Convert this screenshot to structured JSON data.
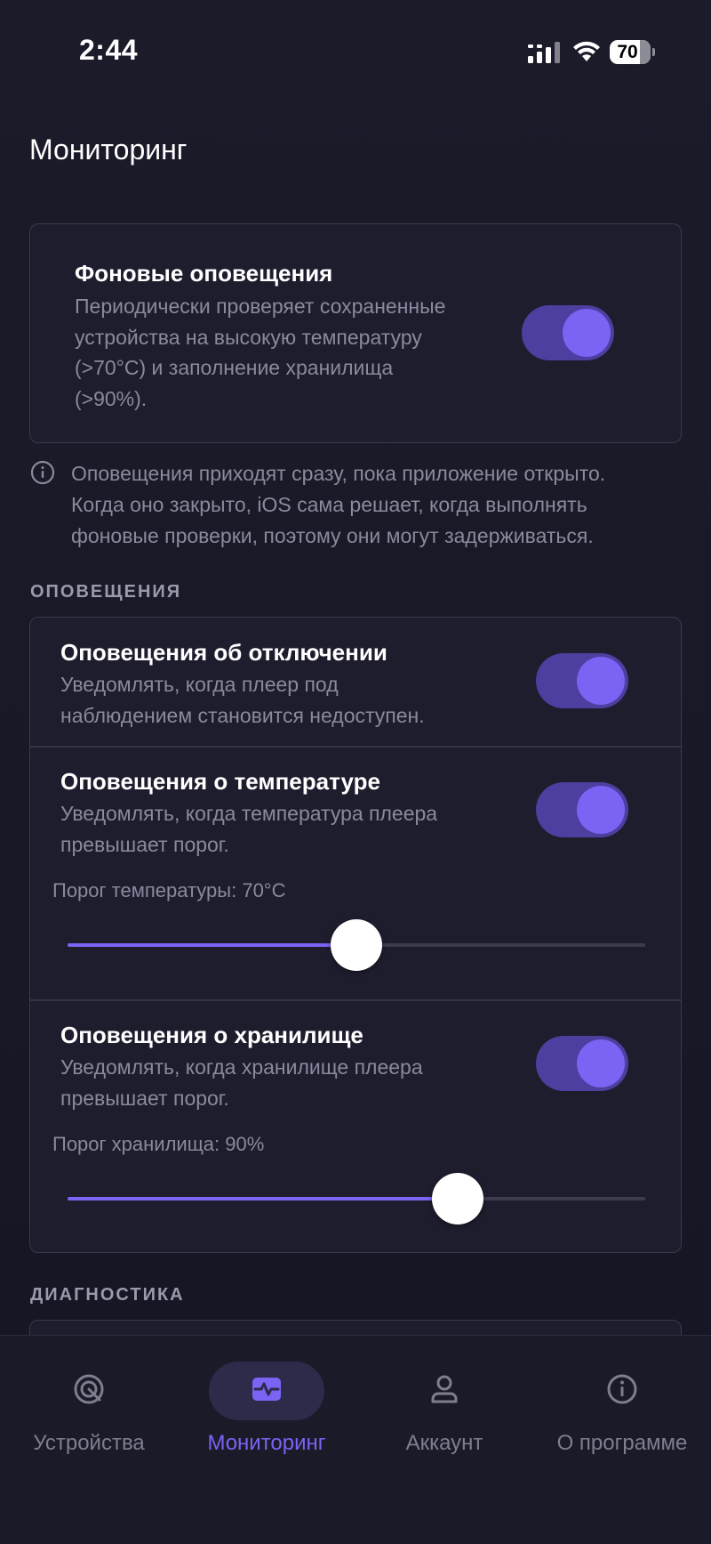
{
  "status_bar": {
    "time": "2:44",
    "battery": "70"
  },
  "page": {
    "title": "Мониторинг"
  },
  "background_alerts": {
    "title": "Фоновые оповещения",
    "description_lines": [
      "Периодически проверяет сохраненные",
      "устройства на высокую температуру",
      "(>70°C) и заполнение хранилища",
      "(>90%)."
    ],
    "enabled": true
  },
  "info_note": {
    "lines": [
      "Оповещения приходят сразу, пока приложение открыто.",
      "Когда оно закрыто, iOS сама решает, когда выполнять",
      "фоновые проверки, поэтому они могут задерживаться."
    ]
  },
  "alerts_section": {
    "header": "ОПОВЕЩЕНИЯ",
    "offline": {
      "title": "Оповещения об отключении",
      "description_lines": [
        "Уведомлять, когда плеер под",
        "наблюдением становится недоступен."
      ],
      "enabled": true
    },
    "temperature": {
      "title": "Оповещения о температуре",
      "description_lines": [
        "Уведомлять, когда температура плеера",
        "превышает порог."
      ],
      "enabled": true,
      "threshold_label": "Порог температуры: 70°C",
      "slider_fraction": 0.5
    },
    "storage": {
      "title": "Оповещения о хранилище",
      "description_lines": [
        "Уведомлять, когда хранилище плеера",
        "превышает порог."
      ],
      "enabled": true,
      "threshold_label": "Порог хранилища: 90%",
      "slider_fraction": 0.675
    }
  },
  "diagnostics_section": {
    "header": "ДИАГНОСТИКА"
  },
  "tabbar": {
    "tabs": [
      {
        "label": "Устройства",
        "icon": "target-icon",
        "active": false
      },
      {
        "label": "Мониторинг",
        "icon": "pulse-monitor-icon",
        "active": true
      },
      {
        "label": "Аккаунт",
        "icon": "person-icon",
        "active": false
      },
      {
        "label": "О программе",
        "icon": "info-circle-icon",
        "active": false
      }
    ]
  },
  "colors": {
    "accent": "#7b63f3",
    "toggle_track": "#4d3f9f",
    "background": "#1a1a29",
    "card": "#1e1d2e",
    "muted_text": "#8a8a9e"
  }
}
